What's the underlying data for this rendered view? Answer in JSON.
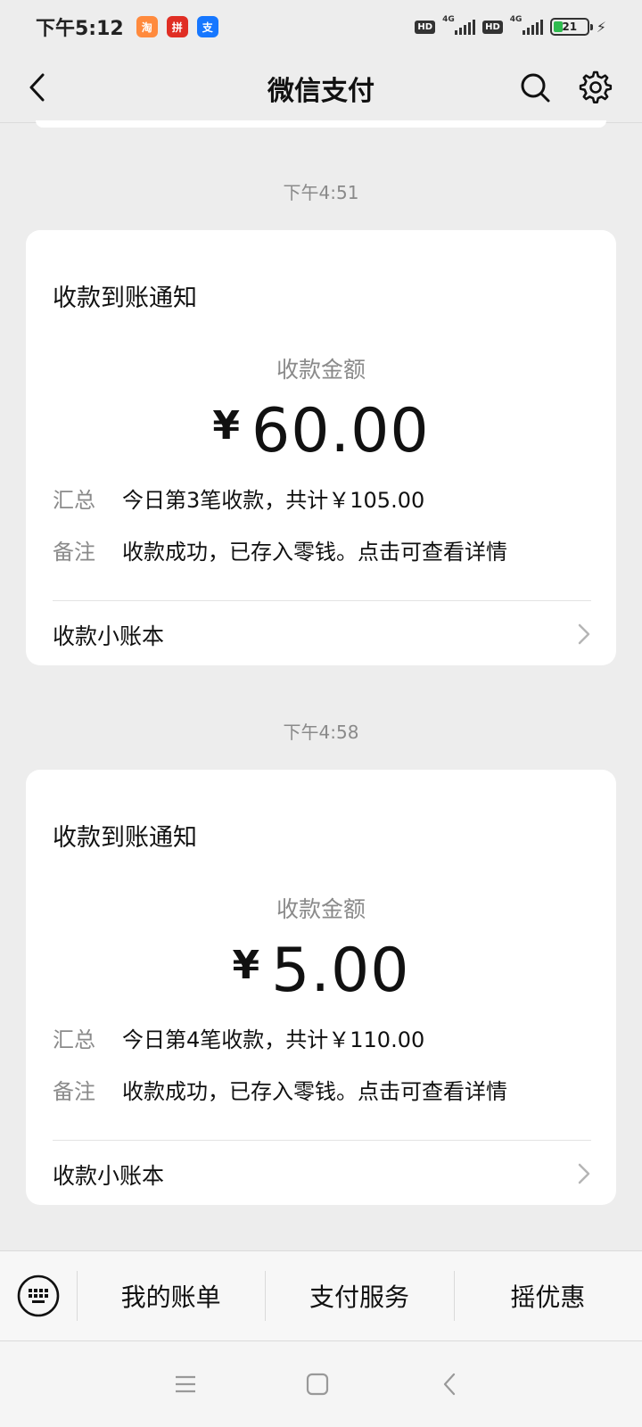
{
  "status_bar": {
    "time": "下午5:12",
    "apps": [
      {
        "icon": "taobao-app-icon",
        "text": "淘",
        "color": "#ff8a3d"
      },
      {
        "icon": "pinduoduo-app-icon",
        "text": "拼",
        "color": "#e02e24"
      },
      {
        "icon": "alipay-app-icon",
        "text": "支",
        "color": "#1677ff"
      }
    ],
    "hd1": "HD",
    "net1": "4G",
    "hd2": "HD",
    "net2": "4G",
    "battery": "21"
  },
  "nav": {
    "title": "微信支付"
  },
  "messages": [
    {
      "time": "下午4:51",
      "title": "收款到账通知",
      "amount_label": "收款金额",
      "currency": "¥",
      "amount": "60.00",
      "summary_key": "汇总",
      "summary_value": "今日第3笔收款，共计￥105.00",
      "note_key": "备注",
      "note_value": "收款成功，已存入零钱。点击可查看详情",
      "footer": "收款小账本"
    },
    {
      "time": "下午4:58",
      "title": "收款到账通知",
      "amount_label": "收款金额",
      "currency": "¥",
      "amount": "5.00",
      "summary_key": "汇总",
      "summary_value": "今日第4笔收款，共计￥110.00",
      "note_key": "备注",
      "note_value": "收款成功，已存入零钱。点击可查看详情",
      "footer": "收款小账本"
    }
  ],
  "bottom_menu": {
    "items": [
      "我的账单",
      "支付服务",
      "摇优惠"
    ]
  }
}
